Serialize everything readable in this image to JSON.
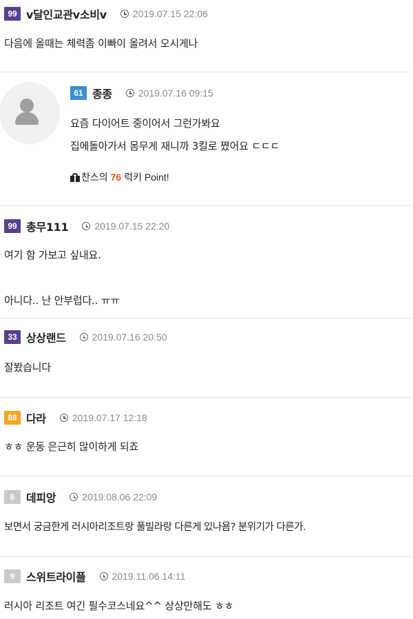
{
  "comments": [
    {
      "level": "99",
      "level_color": "#5b3f8e",
      "author": "v달인교관v소비v",
      "time": "2019.07.15 22:06",
      "lines": [
        "다음에 올때는 체력좀 이빠이 올려서 오시게나"
      ]
    },
    {
      "level": "61",
      "level_color": "#3a8fd6",
      "author": "종종",
      "time": "2019.07.16 09:15",
      "lines": [
        "요즘 다이어트 중이어서 그런가봐요",
        "집에돌아가서 몸무게 재니까 3킬로 쪘어요 ㄷㄷㄷ"
      ],
      "lucky": {
        "prefix": "찬스의",
        "number": "76",
        "suffix": "럭키 Point!"
      }
    },
    {
      "level": "99",
      "level_color": "#5b3f8e",
      "author": "총무111",
      "time": "2019.07.15 22:20",
      "lines": [
        "여기 함 가보고 싶내요.",
        "아니다.. 난 안부럽다.. ㅠㅠ"
      ]
    },
    {
      "level": "33",
      "level_color": "#5b3f8e",
      "author": "상상랜드",
      "time": "2019.07.16 20:50",
      "lines": [
        "잘봤습니다"
      ]
    },
    {
      "level": "88",
      "level_color": "#f5a623",
      "author": "다라",
      "time": "2019.07.17 12:18",
      "lines": [
        "ㅎㅎ 운동 은근히 많이하게 되죠"
      ]
    },
    {
      "level": "6",
      "level_color": "#c9c9c9",
      "author": "데피앙",
      "time": "2019.08.06 22:09",
      "lines": [
        "보면서 궁금한게 러시아리조트랑 풀빌라랑 다른게 있나욤? 분위기가 다른가."
      ]
    },
    {
      "level": "9",
      "level_color": "#c9c9c9",
      "author": "스위트라이플",
      "time": "2019.11.06 14:11",
      "lines": [
        "러시아 리조트 여긴 필수코스네요^^ 상상만해도 ㅎㅎ"
      ]
    }
  ]
}
